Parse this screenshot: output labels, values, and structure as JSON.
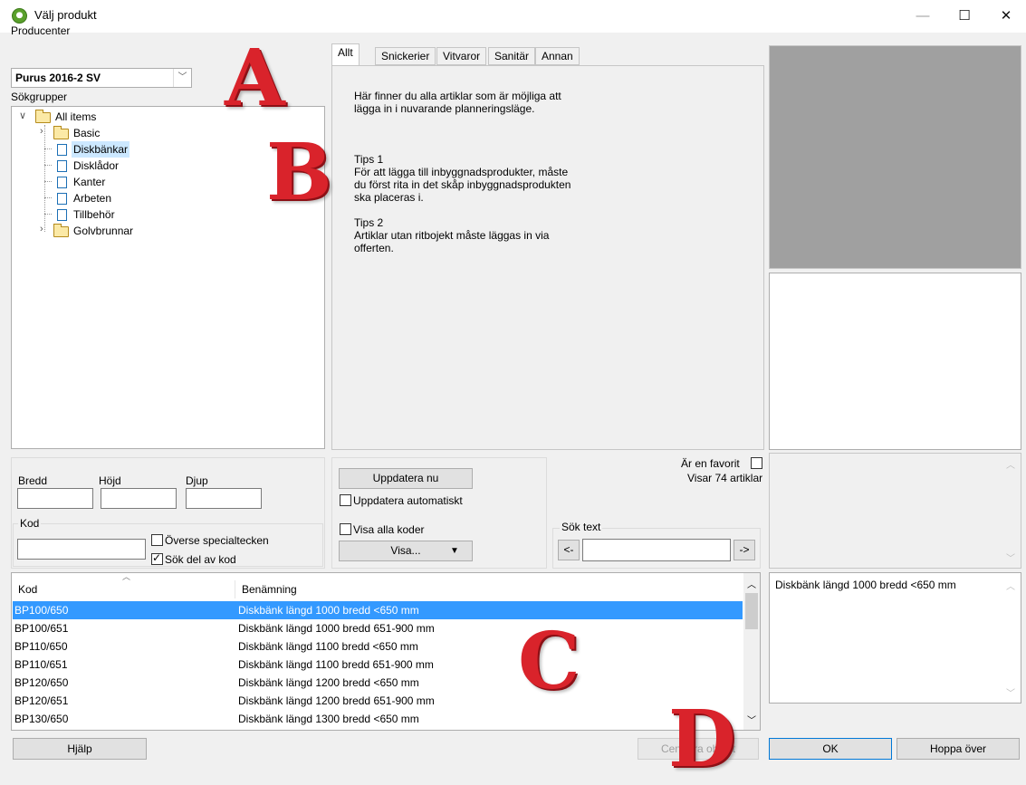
{
  "window": {
    "title": "Välj produkt",
    "minimize": "—",
    "maximize": "☐",
    "close": "✕"
  },
  "producenter": {
    "label": "Producenter",
    "value": "Purus 2016-2 SV"
  },
  "sokgrupper": {
    "label": "Sökgrupper",
    "tree": [
      {
        "label": "All items",
        "type": "folder",
        "level": 0,
        "expanded": true
      },
      {
        "label": "Basic",
        "type": "folder",
        "level": 1,
        "expanded": false
      },
      {
        "label": "Diskbänkar",
        "type": "doc",
        "level": 1,
        "selected": true
      },
      {
        "label": "Disklådor",
        "type": "doc",
        "level": 1
      },
      {
        "label": "Kanter",
        "type": "doc",
        "level": 1
      },
      {
        "label": "Arbeten",
        "type": "doc",
        "level": 1
      },
      {
        "label": "Tillbehör",
        "type": "doc",
        "level": 1
      },
      {
        "label": "Golvbrunnar",
        "type": "folder",
        "level": 1,
        "expanded": false
      }
    ]
  },
  "tabs": [
    "Allt",
    "Snickerier",
    "Vitvaror",
    "Sanitär",
    "Annan"
  ],
  "info": {
    "p1_line1": "Här finner du alla artiklar som är möjliga att",
    "p1_line2": "lägga in i nuvarande planneringsläge.",
    "tips1_title": "Tips 1",
    "tips1_line1": "För att lägga till inbyggnadsprodukter, måste",
    "tips1_line2": "du först rita in det skåp inbyggnadsprodukten",
    "tips1_line3": "ska placeras i.",
    "tips2_title": "Tips 2",
    "tips2_line1": "Artiklar utan ritbojekt måste läggas in via",
    "tips2_line2": "offerten."
  },
  "dimensions": {
    "bredd": "Bredd",
    "hojd": "Höjd",
    "djup": "Djup"
  },
  "kod": {
    "label": "Kod",
    "overse": "Överse specialtecken",
    "sok_del": "Sök del av kod"
  },
  "update": {
    "button": "Uppdatera nu",
    "auto": "Uppdatera automatiskt",
    "visa_alla": "Visa alla koder",
    "visa_button": "Visa..."
  },
  "favorit": {
    "label": "Är en favorit",
    "count": "Visar 74 artiklar"
  },
  "sok_text": {
    "label": "Sök text",
    "prev": "<-",
    "next": "->"
  },
  "table": {
    "headers": {
      "kod": "Kod",
      "benamning": "Benämning"
    },
    "rows": [
      {
        "kod": "BP100/650",
        "benamning": "Diskbänk längd 1000 bredd <650 mm"
      },
      {
        "kod": "BP100/651",
        "benamning": "Diskbänk längd 1000 bredd 651-900 mm"
      },
      {
        "kod": "BP110/650",
        "benamning": "Diskbänk längd 1100 bredd <650 mm"
      },
      {
        "kod": "BP110/651",
        "benamning": "Diskbänk längd 1100 bredd 651-900 mm"
      },
      {
        "kod": "BP120/650",
        "benamning": "Diskbänk längd 1200  bredd <650 mm"
      },
      {
        "kod": "BP120/651",
        "benamning": "Diskbänk längd 1200 bredd 651-900 mm"
      },
      {
        "kod": "BP130/650",
        "benamning": "Diskbänk längd 1300 bredd <650 mm"
      }
    ]
  },
  "description": "Diskbänk längd 1000 bredd <650 mm",
  "buttons": {
    "help": "Hjälp",
    "center": "Centrera objekt",
    "ok": "OK",
    "skip": "Hoppa över"
  },
  "overlay": {
    "a": "A",
    "b": "B",
    "c": "C",
    "d": "D"
  },
  "colors": {
    "selection": "#3399ff",
    "preview": "#a0a0a0",
    "overlay": "#d9232b"
  }
}
